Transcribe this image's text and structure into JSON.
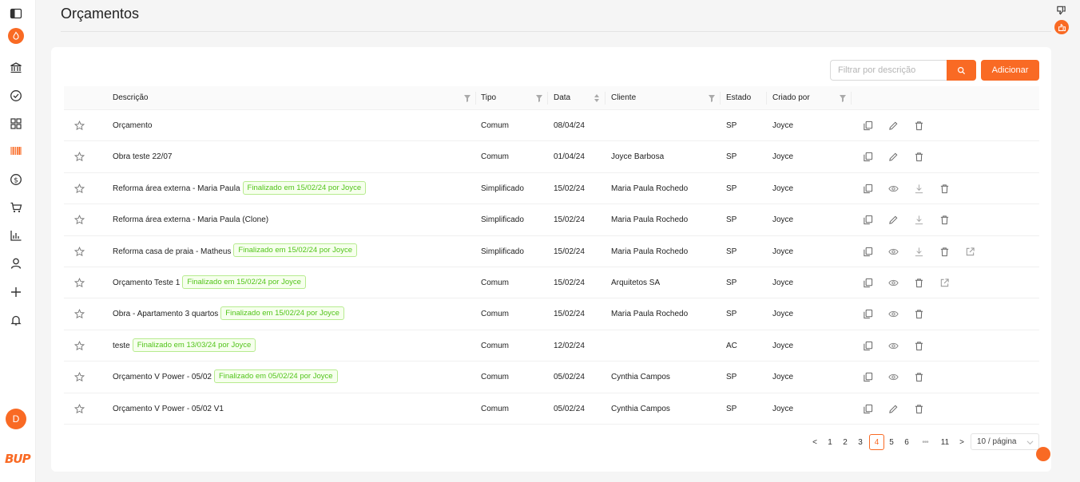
{
  "page": {
    "title": "Orçamentos"
  },
  "toolbar": {
    "filter_placeholder": "Filtrar por descrição",
    "add_label": "Adicionar"
  },
  "user": {
    "avatar_initial": "D"
  },
  "brand": {
    "logo_text": "BUP",
    "accent": "#f96a24"
  },
  "table": {
    "columns": [
      "Descrição",
      "Tipo",
      "Data",
      "Cliente",
      "Estado",
      "Criado por"
    ],
    "rows": [
      {
        "descricao": "Orçamento",
        "tag": "",
        "tipo": "Comum",
        "data": "08/04/24",
        "cliente": "",
        "estado": "SP",
        "criado": "Joyce",
        "actions": [
          "copy",
          "edit",
          "delete"
        ]
      },
      {
        "descricao": "Obra teste 22/07",
        "tag": "",
        "tipo": "Comum",
        "data": "01/04/24",
        "cliente": "Joyce Barbosa",
        "estado": "SP",
        "criado": "Joyce",
        "actions": [
          "copy",
          "edit",
          "delete"
        ]
      },
      {
        "descricao": "Reforma área externa - Maria Paula",
        "tag": "Finalizado em 15/02/24 por Joyce",
        "tipo": "Simplificado",
        "data": "15/02/24",
        "cliente": "Maria Paula Rochedo",
        "estado": "SP",
        "criado": "Joyce",
        "actions": [
          "copy",
          "view",
          "download",
          "delete"
        ]
      },
      {
        "descricao": "Reforma área externa - Maria Paula (Clone)",
        "tag": "",
        "tipo": "Simplificado",
        "data": "15/02/24",
        "cliente": "Maria Paula Rochedo",
        "estado": "SP",
        "criado": "Joyce",
        "actions": [
          "copy",
          "edit",
          "download",
          "delete"
        ]
      },
      {
        "descricao": "Reforma casa de praia - Matheus",
        "tag": "Finalizado em 15/02/24 por Joyce",
        "tipo": "Simplificado",
        "data": "15/02/24",
        "cliente": "Maria Paula Rochedo",
        "estado": "SP",
        "criado": "Joyce",
        "actions": [
          "copy",
          "view",
          "download",
          "delete",
          "share"
        ]
      },
      {
        "descricao": "Orçamento Teste 1",
        "tag": "Finalizado em 15/02/24 por Joyce",
        "tipo": "Comum",
        "data": "15/02/24",
        "cliente": "Arquitetos SA",
        "estado": "SP",
        "criado": "Joyce",
        "actions": [
          "copy",
          "view",
          "delete",
          "share"
        ]
      },
      {
        "descricao": "Obra - Apartamento 3 quartos",
        "tag": "Finalizado em 15/02/24 por Joyce",
        "tipo": "Comum",
        "data": "15/02/24",
        "cliente": "Maria Paula Rochedo",
        "estado": "SP",
        "criado": "Joyce",
        "actions": [
          "copy",
          "view",
          "delete"
        ]
      },
      {
        "descricao": "teste",
        "tag": "Finalizado em 13/03/24 por Joyce",
        "tipo": "Comum",
        "data": "12/02/24",
        "cliente": "",
        "estado": "AC",
        "criado": "Joyce",
        "actions": [
          "copy",
          "view",
          "delete"
        ]
      },
      {
        "descricao": "Orçamento V Power - 05/02",
        "tag": "Finalizado em 05/02/24 por Joyce",
        "tipo": "Comum",
        "data": "05/02/24",
        "cliente": "Cynthia Campos",
        "estado": "SP",
        "criado": "Joyce",
        "actions": [
          "copy",
          "view",
          "delete"
        ]
      },
      {
        "descricao": "Orçamento V Power - 05/02 V1",
        "tag": "",
        "tipo": "Comum",
        "data": "05/02/24",
        "cliente": "Cynthia Campos",
        "estado": "SP",
        "criado": "Joyce",
        "actions": [
          "copy",
          "edit",
          "delete"
        ]
      }
    ]
  },
  "pagination": {
    "prev": "<",
    "pages": [
      "1",
      "2",
      "3",
      "4",
      "5",
      "6",
      "•••",
      "11"
    ],
    "current": "4",
    "next": ">",
    "page_size": "10 / página"
  },
  "sidebar": {
    "items": [
      "panel-toggle-icon",
      "flame-icon",
      "bank-icon",
      "check-circle-icon",
      "grid-icon",
      "barcode-icon",
      "dollar-icon",
      "cart-icon",
      "bar-chart-icon",
      "user-icon",
      "plus-icon",
      "bell-icon"
    ]
  }
}
